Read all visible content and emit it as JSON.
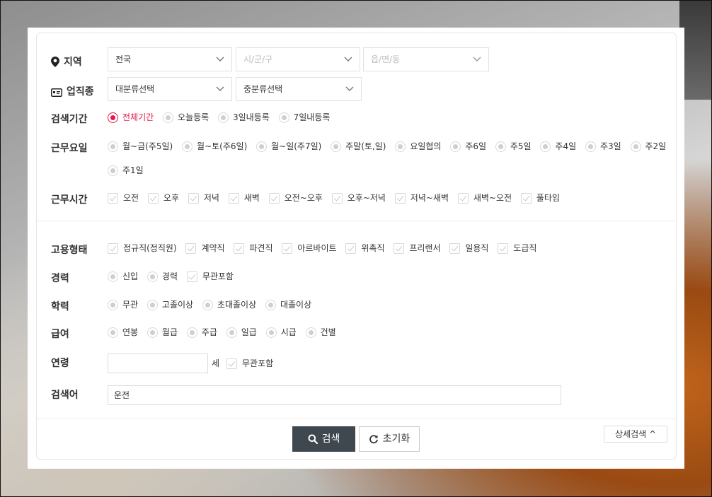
{
  "region": {
    "label": "지역",
    "selects": [
      {
        "value": "전국",
        "placeholder": false
      },
      {
        "value": "시/군/구",
        "placeholder": true
      },
      {
        "value": "읍/면/동",
        "placeholder": true
      }
    ]
  },
  "job_type": {
    "label": "업직종",
    "selects": [
      {
        "value": "대분류선택",
        "placeholder": false
      },
      {
        "value": "중분류선택",
        "placeholder": false
      }
    ]
  },
  "search_period": {
    "label": "검색기간",
    "options": [
      "전체기간",
      "오늘등록",
      "3일내등록",
      "7일내등록"
    ],
    "selected": "전체기간"
  },
  "work_days": {
    "label": "근무요일",
    "options": [
      "월~금(주5일)",
      "월~토(주6일)",
      "월~일(주7일)",
      "주말(토,일)",
      "요일협의",
      "주6일",
      "주5일",
      "주4일",
      "주3일",
      "주2일",
      "주1일"
    ]
  },
  "work_time": {
    "label": "근무시간",
    "options": [
      "오전",
      "오후",
      "저녁",
      "새벽",
      "오전~오후",
      "오후~저녁",
      "저녁~새벽",
      "새벽~오전",
      "풀타임"
    ]
  },
  "employment_type": {
    "label": "고용형태",
    "options": [
      "정규직(정직원)",
      "계약직",
      "파견직",
      "아르바이트",
      "위촉직",
      "프리랜서",
      "일용직",
      "도급직"
    ]
  },
  "career": {
    "label": "경력",
    "radios": [
      "신입",
      "경력"
    ],
    "checkbox": "무관포함"
  },
  "education": {
    "label": "학력",
    "options": [
      "무관",
      "고졸이상",
      "초대졸이상",
      "대졸이상"
    ]
  },
  "salary": {
    "label": "급여",
    "options": [
      "연봉",
      "월급",
      "주급",
      "일급",
      "시급",
      "건별"
    ]
  },
  "age": {
    "label": "연령",
    "value": "",
    "unit": "세",
    "checkbox": "무관포함"
  },
  "keyword": {
    "label": "검색어",
    "value": "운전"
  },
  "buttons": {
    "search": "검색",
    "reset": "초기화",
    "detail": "상세검색 ^"
  },
  "colors": {
    "accent": "#e8174a",
    "search_button": "#3f474f"
  }
}
